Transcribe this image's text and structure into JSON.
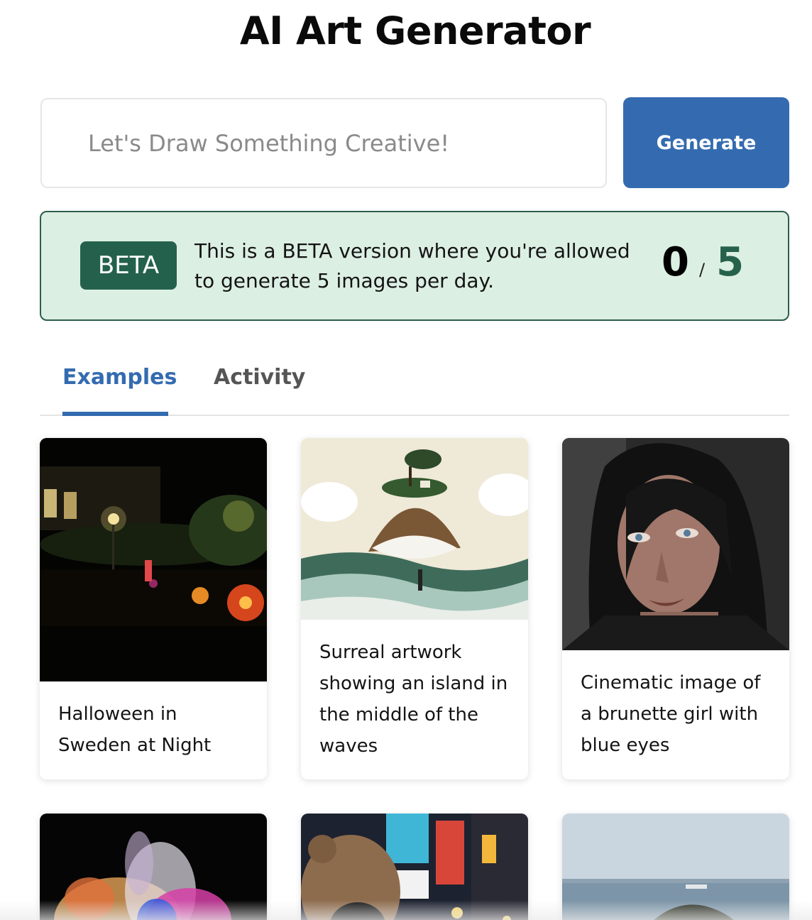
{
  "header": {
    "title": "AI Art Generator"
  },
  "prompt": {
    "placeholder": "Let's Draw Something Creative!",
    "value": ""
  },
  "generate_button": {
    "label": "Generate",
    "color": "#346bb0"
  },
  "beta_notice": {
    "badge": "BETA",
    "message": "This is a BETA version where you're allowed to generate 5 images per day.",
    "used": "0",
    "separator": "/",
    "limit": "5",
    "background": "#dcefe3",
    "accent": "#24614d"
  },
  "tabs": [
    {
      "label": "Examples",
      "active": true
    },
    {
      "label": "Activity",
      "active": false
    }
  ],
  "examples": [
    {
      "caption": "Halloween in Sweden at Night",
      "image": "night-garden-pumpkins-image"
    },
    {
      "caption": "Surreal artwork showing an island in the middle of the waves",
      "image": "surreal-island-waves-image"
    },
    {
      "caption": "Cinematic image of a brunette girl with blue eyes",
      "image": "brunette-portrait-image"
    },
    {
      "caption": "",
      "image": "color-powder-explosion-image"
    },
    {
      "caption": "",
      "image": "teddy-bear-city-night-image"
    },
    {
      "caption": "",
      "image": "sea-island-landscape-image"
    }
  ]
}
